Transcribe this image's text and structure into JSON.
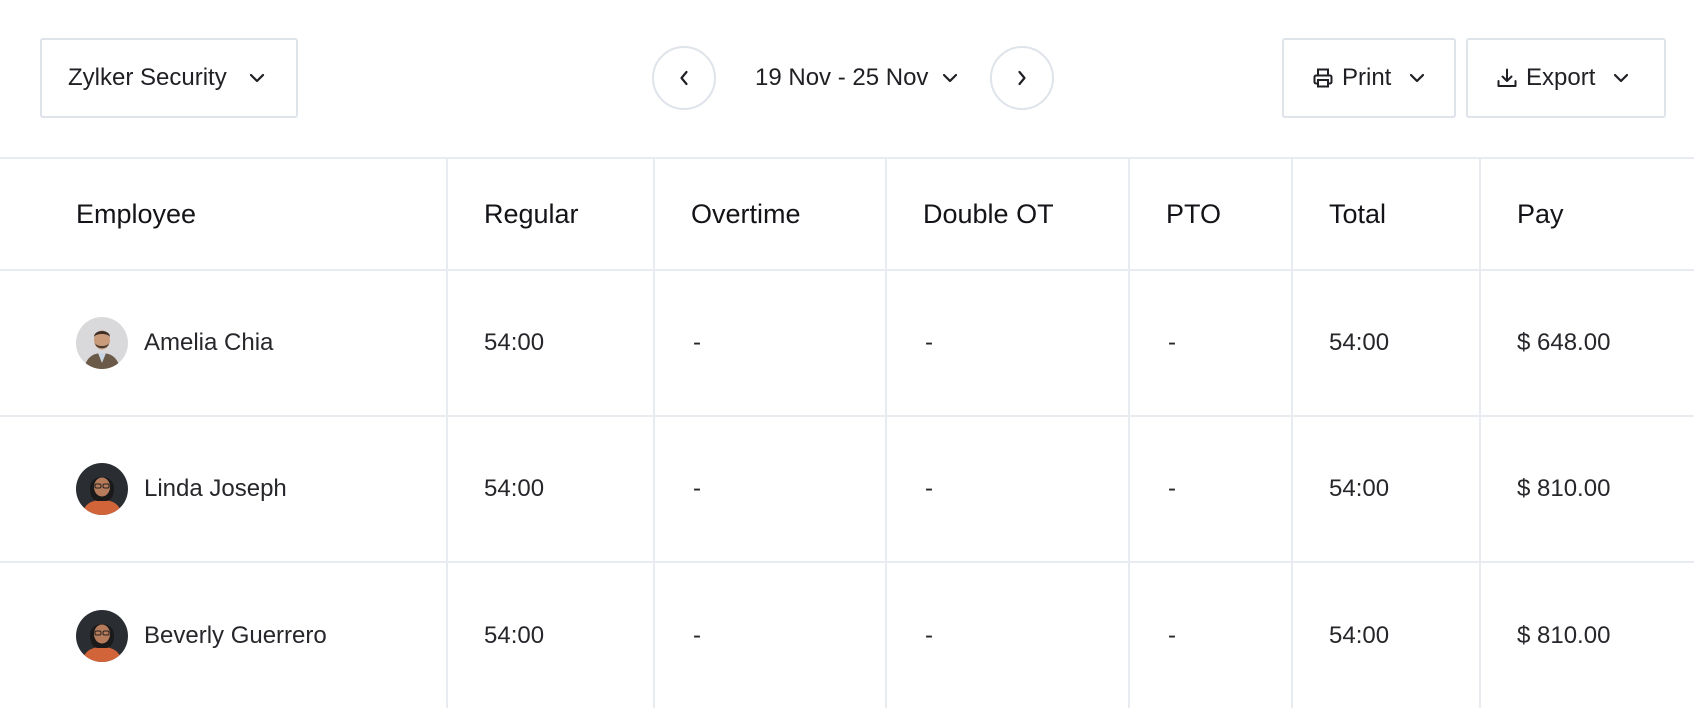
{
  "toolbar": {
    "company": "Zylker Security",
    "date_range": "19 Nov - 25 Nov",
    "print_label": "Print",
    "export_label": "Export"
  },
  "table": {
    "columns": [
      "Employee",
      "Regular",
      "Overtime",
      "Double OT",
      "PTO",
      "Total",
      "Pay"
    ],
    "rows": [
      {
        "employee": "Amelia Chia",
        "regular": "54:00",
        "overtime": "-",
        "double_ot": "-",
        "pto": "-",
        "total": "54:00",
        "pay": "$ 648.00"
      },
      {
        "employee": "Linda Joseph",
        "regular": "54:00",
        "overtime": "-",
        "double_ot": "-",
        "pto": "-",
        "total": "54:00",
        "pay": "$ 810.00"
      },
      {
        "employee": "Beverly Guerrero",
        "regular": "54:00",
        "overtime": "-",
        "double_ot": "-",
        "pto": "-",
        "total": "54:00",
        "pay": "$ 810.00"
      }
    ]
  },
  "icons": {
    "company_dropdown": "chevron-down-icon",
    "prev": "chevron-left-icon",
    "next": "chevron-right-icon",
    "date_dropdown": "chevron-down-icon",
    "print": "printer-icon",
    "export": "download-icon"
  },
  "colors": {
    "border": "#dfe3ea",
    "grid": "#e8ebf0",
    "text": "#1f1f24"
  }
}
